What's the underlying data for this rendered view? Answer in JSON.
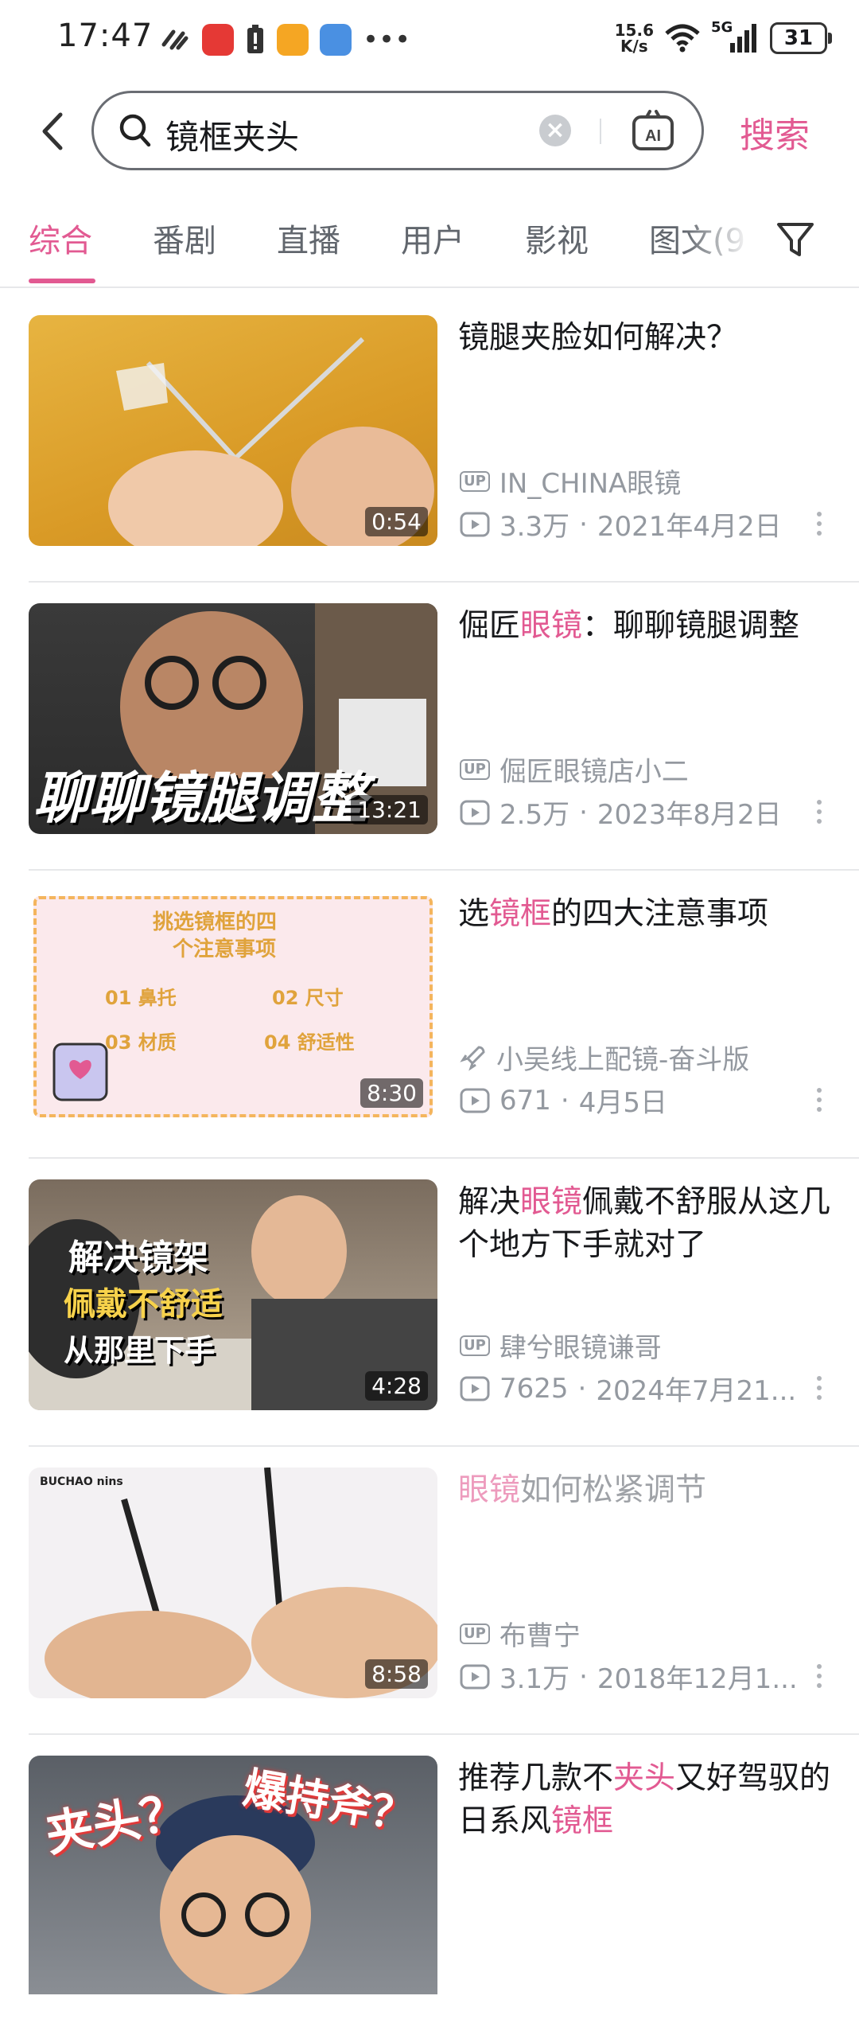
{
  "status_bar": {
    "time": "17:47",
    "net_speed_value": "15.6",
    "net_speed_unit": "K/s",
    "signal": "5G",
    "battery": "31"
  },
  "search": {
    "query": "镜框夹头",
    "submit_label": "搜索",
    "ai_label": "AI"
  },
  "tabs": [
    {
      "label": "综合"
    },
    {
      "label": "番剧"
    },
    {
      "label": "直播"
    },
    {
      "label": "用户"
    },
    {
      "label": "影视"
    },
    {
      "label": "图文(9"
    }
  ],
  "results": [
    {
      "title_parts": [
        "镜腿夹脸如何解决？"
      ],
      "uploader": "IN_CHINA眼镜",
      "uploader_badge": "UP",
      "views": "3.3万",
      "date": "2021年4月2日",
      "duration": "0:54"
    },
    {
      "title_parts": [
        "倔匠",
        "眼镜",
        "：聊聊镜腿调整"
      ],
      "uploader": "倔匠眼镜店小二",
      "uploader_badge": "UP",
      "views": "2.5万",
      "date": "2023年8月2日",
      "duration": "13:21",
      "thumb_caption": "聊聊镜腿调整"
    },
    {
      "title_parts": [
        "选",
        "镜框",
        "的四大注意事项"
      ],
      "uploader": "小吴线上配镜-奋斗版",
      "uploader_badge": "",
      "views": "671",
      "date": "4月5日",
      "duration": "8:30",
      "thumb_lines": [
        "挑选镜框的四",
        "个注意事项",
        "01 鼻托",
        "02 尺寸",
        "03 材质",
        "04 舒适性"
      ]
    },
    {
      "title_parts": [
        "解决",
        "眼镜",
        "佩戴不舒服从这几个地方下手就对了"
      ],
      "uploader": "肆兮眼镜谦哥",
      "uploader_badge": "UP",
      "views": "7625",
      "date": "2024年7月21...",
      "duration": "4:28",
      "thumb_lines": [
        "解决镜架",
        "佩戴不舒适",
        "从那里下手"
      ]
    },
    {
      "title_parts": [
        "眼镜",
        "如何松紧调节"
      ],
      "uploader": "布曹宁",
      "uploader_badge": "UP",
      "views": "3.1万",
      "date": "2018年12月1...",
      "duration": "8:58",
      "thumb_brand": "BUCHAO nins"
    },
    {
      "title_parts": [
        "推荐几款不",
        "夹头",
        "又好驾驭的日系风",
        "镜框"
      ],
      "thumb_lines": [
        "夹头？",
        "爆持斧？"
      ]
    }
  ],
  "colors": {
    "accent": "#e25a92",
    "text": "#18191c",
    "secondary": "#9499a0"
  }
}
